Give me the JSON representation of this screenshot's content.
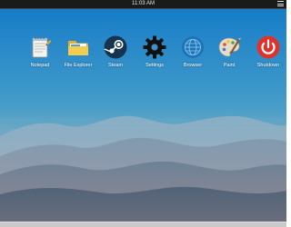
{
  "status_bar": {
    "time": "11:03 AM",
    "background": "#1a1a1a"
  },
  "desktop": {
    "apps": [
      {
        "label": "Notepad",
        "icon": "notepad-icon"
      },
      {
        "label": "File Explorer",
        "icon": "folder-icon"
      },
      {
        "label": "Steam",
        "icon": "steam-icon"
      },
      {
        "label": "Settings",
        "icon": "gear-icon"
      },
      {
        "label": "Browser",
        "icon": "globe-icon"
      },
      {
        "label": "Paint",
        "icon": "palette-icon"
      },
      {
        "label": "Shutdown",
        "icon": "power-icon"
      }
    ]
  },
  "colors": {
    "sky_top": "#0f79c6",
    "sky_mid": "#5aa6c9",
    "horizon": "#c8a09a",
    "shutdown_red": "#e0322b",
    "folder_yellow": "#f3c63f",
    "steam_dark": "#16334f",
    "browser_blue": "#1f74b8"
  }
}
